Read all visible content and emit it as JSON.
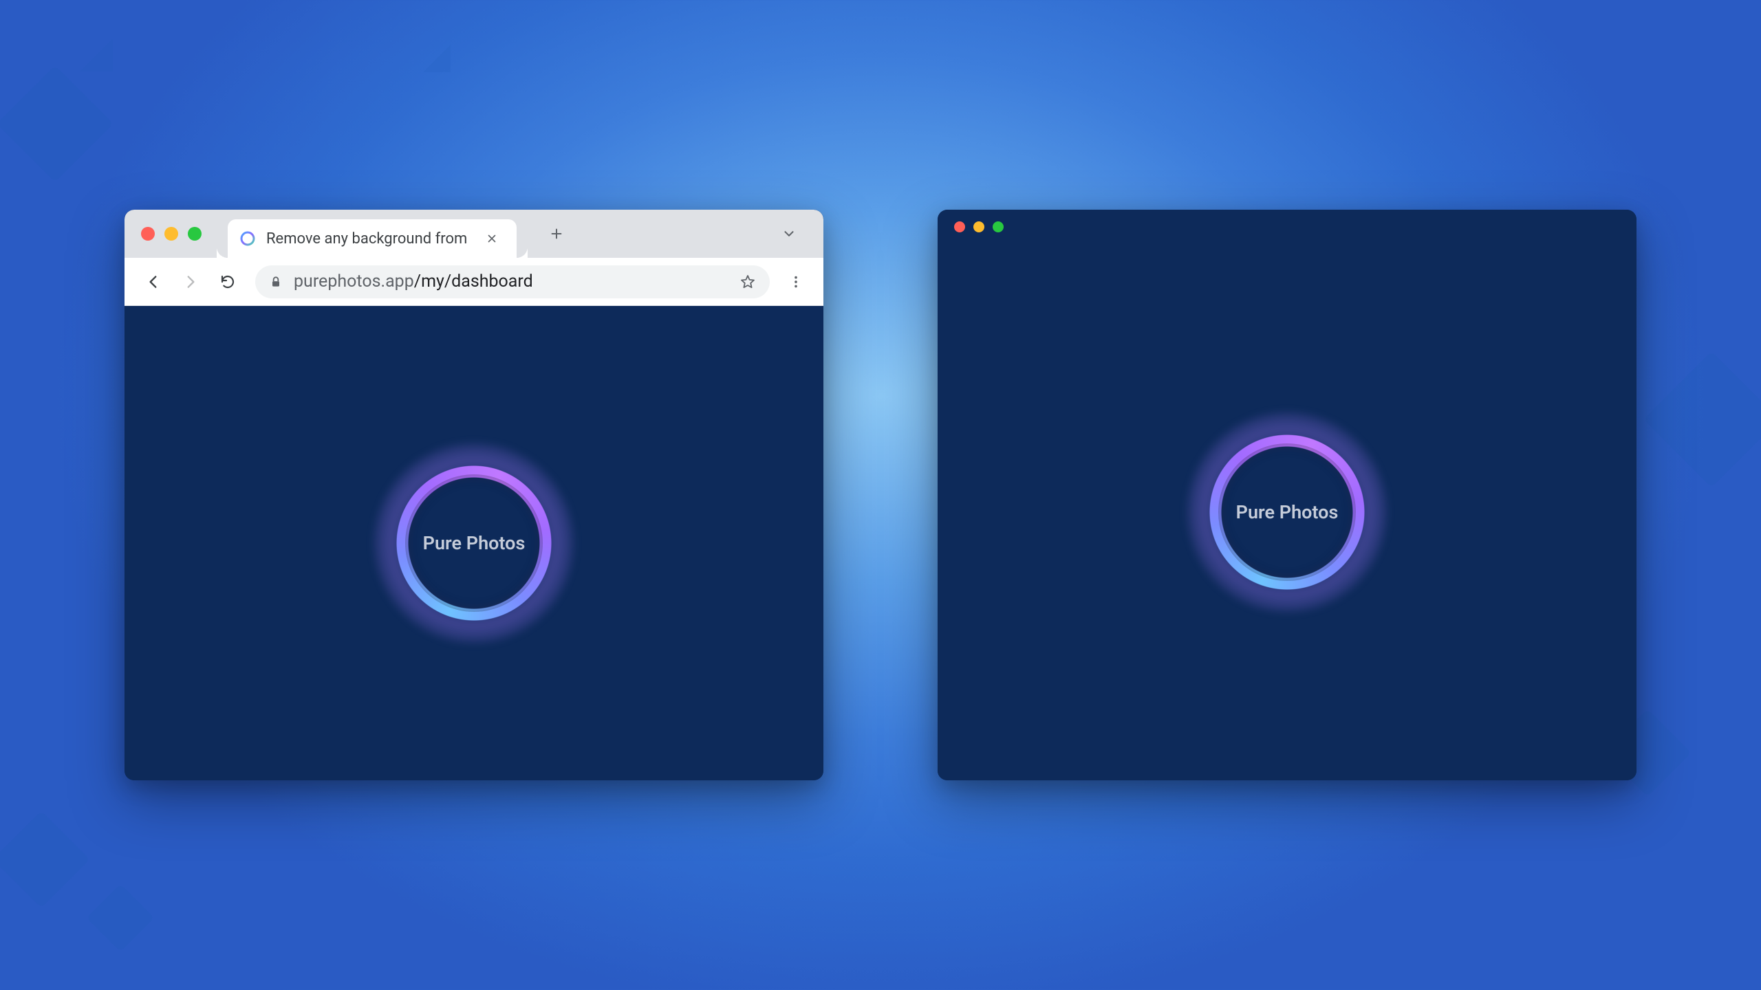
{
  "browser": {
    "tab_title": "Remove any background from",
    "url_host": "purephotos.app",
    "url_path": "/my/dashboard"
  },
  "app": {
    "loader_label": "Pure Photos"
  },
  "colors": {
    "page_bg": "#0d2a5a",
    "accent_ring_start": "#6fc3ff",
    "accent_ring_end": "#c078ff"
  }
}
